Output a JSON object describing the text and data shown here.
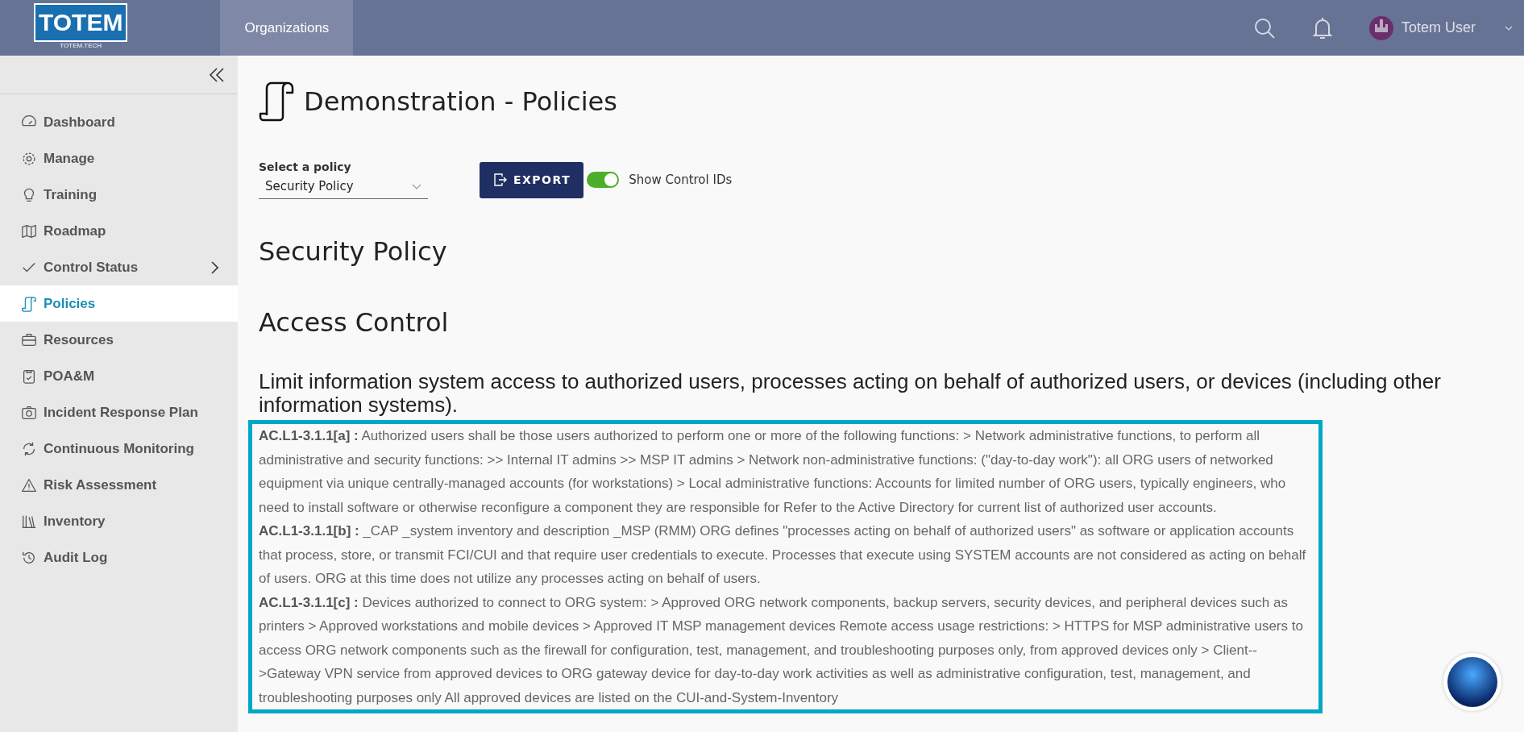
{
  "header": {
    "logo": {
      "word": "TOTEM",
      "caption": "TOTEM.TECH"
    },
    "nav": [
      {
        "label": "Organizations",
        "selected": true
      }
    ],
    "user": {
      "name": "Totem User"
    }
  },
  "sidebar": {
    "items": [
      {
        "label": "Dashboard",
        "selected": false,
        "has_submenu": false
      },
      {
        "label": "Manage",
        "selected": false,
        "has_submenu": false
      },
      {
        "label": "Training",
        "selected": false,
        "has_submenu": false
      },
      {
        "label": "Roadmap",
        "selected": false,
        "has_submenu": false
      },
      {
        "label": "Control Status",
        "selected": false,
        "has_submenu": true
      },
      {
        "label": "Policies",
        "selected": true,
        "has_submenu": false
      },
      {
        "label": "Resources",
        "selected": false,
        "has_submenu": false
      },
      {
        "label": "POA&M",
        "selected": false,
        "has_submenu": false
      },
      {
        "label": "Incident Response Plan",
        "selected": false,
        "has_submenu": false
      },
      {
        "label": "Continuous Monitoring",
        "selected": false,
        "has_submenu": false
      },
      {
        "label": "Risk Assessment",
        "selected": false,
        "has_submenu": false
      },
      {
        "label": "Inventory",
        "selected": false,
        "has_submenu": false
      },
      {
        "label": "Audit Log",
        "selected": false,
        "has_submenu": false
      }
    ]
  },
  "page": {
    "title": "Demonstration - Policies",
    "policy_select": {
      "label": "Select a policy",
      "value": "Security Policy"
    },
    "export_button": "EXPORT",
    "show_control_ids": {
      "label": "Show Control IDs",
      "on": true
    },
    "policy_title": "Security Policy",
    "section_title": "Access Control",
    "requirement": "Limit information system access to authorized users, processes acting on behalf of authorized users, or devices (including other information systems).",
    "controls": [
      "**AC.L1-3.1.1[a] :** Authorized users shall be those users authorized to perform one or more of the following functions: > Network administrative functions, to perform all administrative and security functions: >> Internal IT admins >> MSP IT admins > Network non-administrative functions: (\"day-to-day work\"): all ORG users of networked equipment via unique centrally-managed accounts (for workstations) > Local administrative functions: Accounts for limited number of ORG users, typically engineers, who need to install software or otherwise reconfigure a component they are responsible for Refer to the Active Directory for current list of authorized user accounts.",
      "**AC.L1-3.1.1[b] :** _CAP _system inventory and description _MSP (RMM) ORG defines \"processes acting on behalf of authorized users\" as software or application accounts that process, store, or transmit FCI/CUI and that require user credentials to execute. Processes that execute using SYSTEM accounts are not considered as acting on behalf of users. ORG at this time does not utilize any processes acting on behalf of users.",
      "**AC.L1-3.1.1[c] :** Devices authorized to connect to ORG system: > Approved ORG network components, backup servers, security devices, and peripheral devices such as printers > Approved workstations and mobile devices > Approved IT MSP management devices Remote access usage restrictions: > HTTPS for MSP administrative users to access ORG network components such as the firewall for configuration, test, management, and troubleshooting purposes only, from approved devices only > Client-->Gateway VPN service from approved devices to ORG gateway device for day-to-day work activities as well as administrative configuration, test, management, and troubleshooting purposes only All approved devices are listed on the CUI-and-System-Inventory"
    ]
  }
}
